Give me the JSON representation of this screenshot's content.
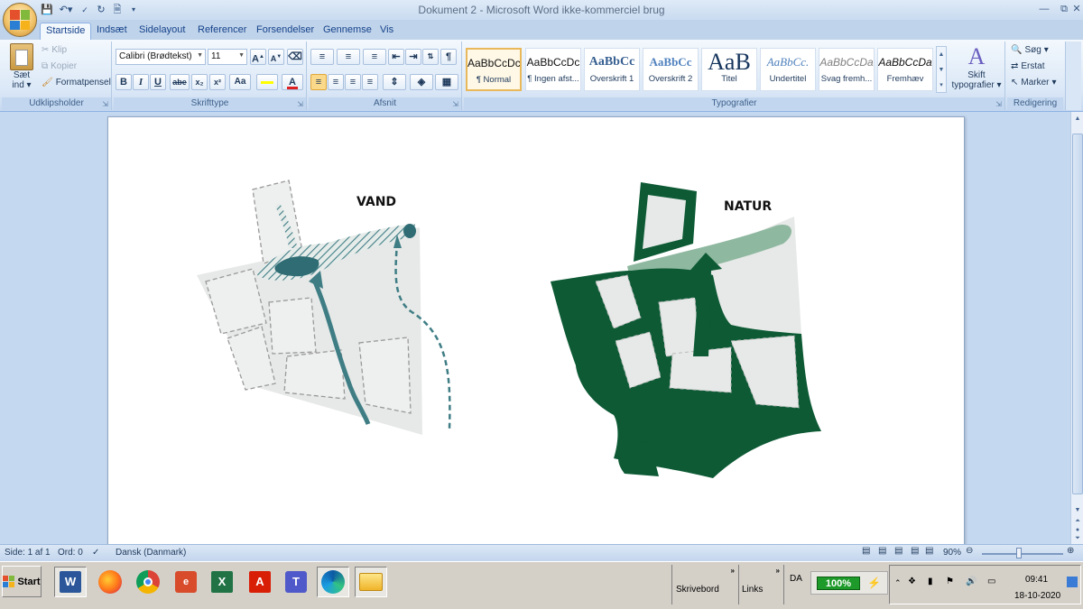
{
  "window": {
    "title": "Dokument 2 - Microsoft Word ikke-kommerciel brug",
    "controls": [
      "minimize-icon",
      "restore-icon",
      "close-icon"
    ]
  },
  "quick_access": [
    "save-icon",
    "undo-icon",
    "spellcheck-icon",
    "redo-icon",
    "print-preview-icon",
    "customize-icon"
  ],
  "tabs": [
    {
      "label": "Startside",
      "active": true
    },
    {
      "label": "Indsæt"
    },
    {
      "label": "Sidelayout"
    },
    {
      "label": "Referencer"
    },
    {
      "label": "Forsendelser"
    },
    {
      "label": "Gennemse"
    },
    {
      "label": "Vis"
    }
  ],
  "ribbon": {
    "clipboard": {
      "label": "Udklipsholder",
      "paste_line1": "Sæt",
      "paste_line2": "ind",
      "cut": "Klip",
      "copy": "Kopier",
      "format_painter": "Formatpensel"
    },
    "font": {
      "label": "Skrifttype",
      "font_name": "Calibri (Brødtekst)",
      "font_size": "11",
      "bold": "B",
      "italic": "I",
      "underline": "U",
      "strike": "abe",
      "subscript": "x₂",
      "superscript": "x²",
      "change_case": "Aa",
      "grow": "A",
      "shrink": "A"
    },
    "paragraph": {
      "label": "Afsnit"
    },
    "styles": {
      "label": "Typografier",
      "items": [
        {
          "sample": "AaBbCcDc",
          "name": "¶ Normal",
          "selected": true
        },
        {
          "sample": "AaBbCcDc",
          "name": "¶ Ingen afst..."
        },
        {
          "sample": "AaBbCc",
          "name": "Overskrift 1"
        },
        {
          "sample": "AaBbCc",
          "name": "Overskrift 2"
        },
        {
          "sample": "AaB",
          "name": "Titel"
        },
        {
          "sample": "AaBbCc.",
          "name": "Undertitel"
        },
        {
          "sample": "AaBbCcDa",
          "name": "Svag fremh..."
        },
        {
          "sample": "AaBbCcDa",
          "name": "Fremhæv"
        }
      ],
      "change_styles_line1": "Skift",
      "change_styles_line2": "typografier"
    },
    "editing": {
      "label": "Redigering",
      "find": "Søg",
      "replace": "Erstat",
      "select": "Marker"
    }
  },
  "document": {
    "left_figure_title": "VAND",
    "right_figure_title": "NATUR",
    "colors": {
      "water": "#3f7d85",
      "nature_dark": "#0d5a35",
      "nature_light": "#8fb8a0",
      "plot": "#e6e9e7"
    }
  },
  "statusbar": {
    "page": "Side: 1 af 1",
    "words": "Ord: 0",
    "language": "Dansk (Danmark)",
    "zoom": "90%"
  },
  "taskbar": {
    "start": "Start",
    "apps": [
      "word-icon",
      "firefox-icon",
      "chrome-icon",
      "libreoffice-impress-icon",
      "excel-icon",
      "acrobat-icon",
      "teams-icon",
      "edge-icon",
      "file-explorer-icon"
    ],
    "toolbar1": "Skrivebord",
    "toolbar2": "Links",
    "lang": "DA",
    "battery": "100%",
    "time": "09:41",
    "date": "18-10-2020"
  }
}
